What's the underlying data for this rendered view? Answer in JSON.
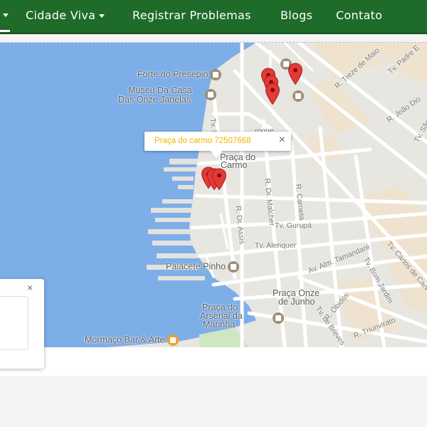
{
  "nav": {
    "items": [
      {
        "label": "Cidade Viva"
      },
      {
        "label": "Registrar Problemas"
      },
      {
        "label": "Blogs"
      },
      {
        "label": "Contato"
      }
    ]
  },
  "map": {
    "places": {
      "forte": "Forte do Presépio",
      "museu_1": "Museu Da Casa",
      "museu_2": "Das Onze Janelas",
      "praca_carmo_1": "Praça do",
      "praca_carmo_2": "Carmo",
      "palacete": "Palacete Pinho",
      "praca_onze_1": "Praça Onze",
      "praca_onze_2": "de Junho",
      "arsenal_1": "Praça do",
      "arsenal_2": "Arsenal da",
      "arsenal_3": "Marinha",
      "mormaco": "Mormaço Bar & Arte"
    },
    "streets": {
      "treze_maio": "R. Treze de Maio",
      "padre": "Tv. Padre E",
      "joao_diogo": "R. João Dio",
      "dr_malcher": "R. Dr. Malcher",
      "carneta": "R. Carneta",
      "dr_assis": "R. Dr. Assis",
      "gurupa": "Tv. Gurupá",
      "alenquer": "Tv. Alenquer",
      "tamandare": "Av. Alm. Tamandaré",
      "carlos": "Tv. Carlos de Carv",
      "bom_jardim": "Tv. Bom Jardim",
      "obidos": "R. Óbidos",
      "breves": "Tv. de Breves",
      "triunvirato": "R. Triunvirato",
      "sao": "Tv. São",
      "sq": "Tv. S",
      "roque": "roque"
    },
    "infowindow": {
      "text": "Praça do carmo 72507668",
      "close": "×"
    }
  },
  "side_card": {
    "close": "×"
  },
  "colors": {
    "navbar": "#1e6b2a",
    "water": "#7eaee8",
    "land": "#e4e2de",
    "block": "#d6d4d0",
    "road": "#ffffff",
    "pin": "#e53935",
    "infowindow_text": "#f0b400"
  }
}
